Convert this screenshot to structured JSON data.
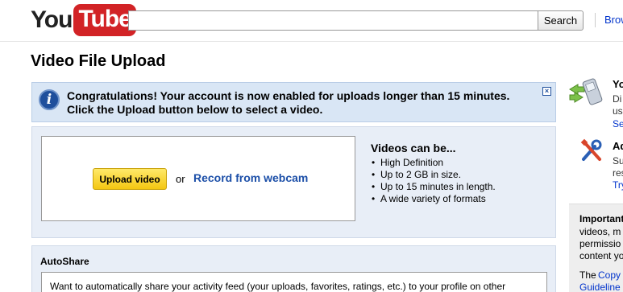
{
  "header": {
    "logo_you": "You",
    "logo_tube": "Tube",
    "search_placeholder": "",
    "search_button": "Search",
    "browse_link": "Brow"
  },
  "page": {
    "title": "Video File Upload"
  },
  "banner": {
    "icon": "info-icon",
    "message": "Congratulations! Your account is now enabled for uploads longer than 15 minutes. Click the Upload button below to select a video.",
    "close": "×"
  },
  "upload": {
    "button": "Upload video",
    "or": "or",
    "webcam_link": "Record from webcam",
    "features_title": "Videos can be...",
    "features": [
      "High Definition",
      "Up to 2 GB in size.",
      "Up to 15 minutes in length.",
      "A wide variety of formats"
    ]
  },
  "autoshare": {
    "title": "AutoShare",
    "text": "Want to automatically share your activity feed (your uploads, favorites, ratings, etc.) to your profile on other"
  },
  "sidebar": {
    "mobile": {
      "icon": "mobile-phone-icon",
      "title": "Yo",
      "lines": [
        "Di",
        "us"
      ],
      "link": "Se"
    },
    "advanced": {
      "icon": "tools-icon",
      "title": "Ad",
      "lines": [
        "Su",
        "res"
      ],
      "link": "Try"
    },
    "important": {
      "title": "Important",
      "lines": [
        "videos, m",
        "permissio",
        "content yo"
      ],
      "line4": "The",
      "link1": "Copy",
      "link2": "Guideline"
    }
  }
}
